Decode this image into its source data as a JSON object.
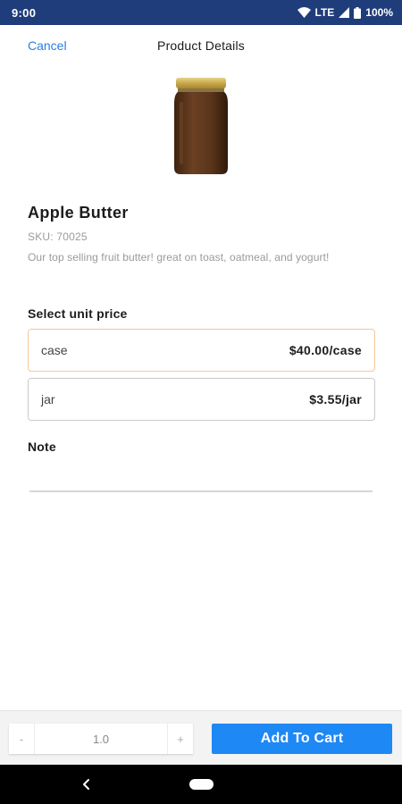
{
  "status_bar": {
    "time": "9:00",
    "network": "LTE",
    "battery": "100%",
    "icons": [
      "wifi-icon",
      "signal-icon",
      "battery-icon"
    ]
  },
  "header": {
    "cancel_label": "Cancel",
    "title": "Product Details"
  },
  "product": {
    "image_icon": "jar-icon",
    "name": "Apple Butter",
    "sku": "SKU: 70025",
    "description": "Our top selling fruit butter! great on toast, oatmeal, and yogurt!"
  },
  "unit_price": {
    "label": "Select unit price",
    "options": [
      {
        "unit": "case",
        "price": "$40.00/case",
        "selected": true
      },
      {
        "unit": "jar",
        "price": "$3.55/jar",
        "selected": false
      }
    ]
  },
  "note": {
    "label": "Note",
    "value": ""
  },
  "bottom_bar": {
    "decrement_label": "-",
    "quantity": "1.0",
    "increment_label": "+",
    "add_to_cart_label": "Add To Cart"
  },
  "colors": {
    "status_bar": "#1f3d7a",
    "accent": "#1e88f5",
    "link": "#2a7de1",
    "selected_border": "#f5c897"
  }
}
